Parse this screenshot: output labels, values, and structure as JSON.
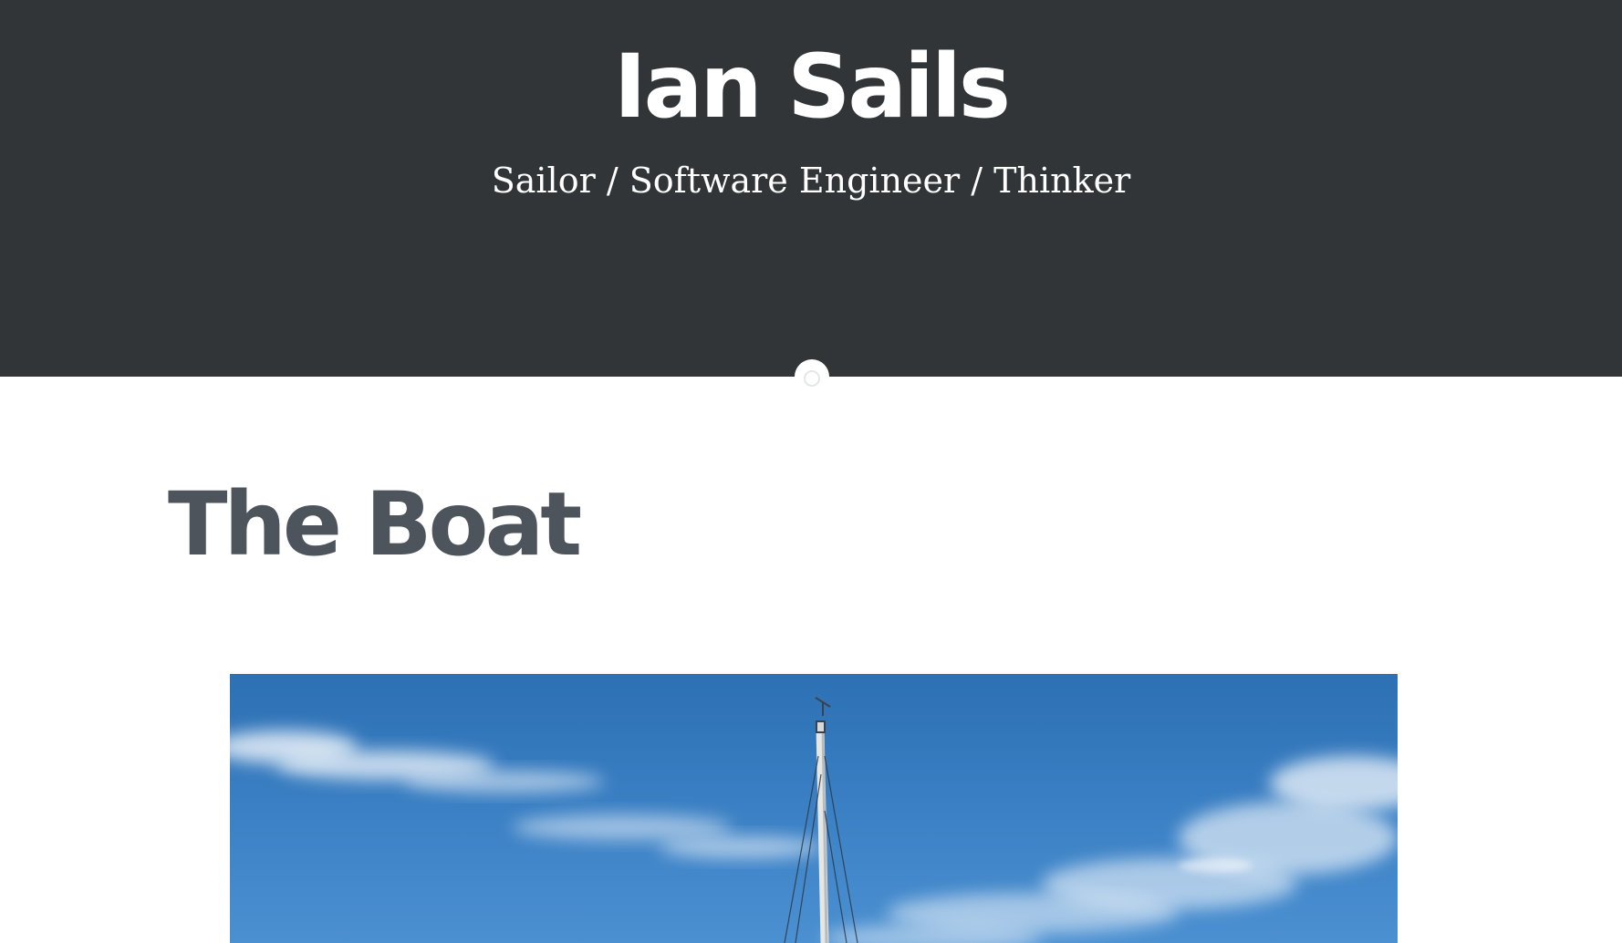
{
  "header": {
    "site_title": "Ian Sails",
    "tagline": "Sailor / Software Engineer / Thinker",
    "background_color": "#313538"
  },
  "post": {
    "title": "The Boat",
    "title_color": "#4d545c",
    "image": {
      "subject": "sailboat-mast-against-blue-sky-photo",
      "sky_color": "#3c82c6"
    }
  }
}
